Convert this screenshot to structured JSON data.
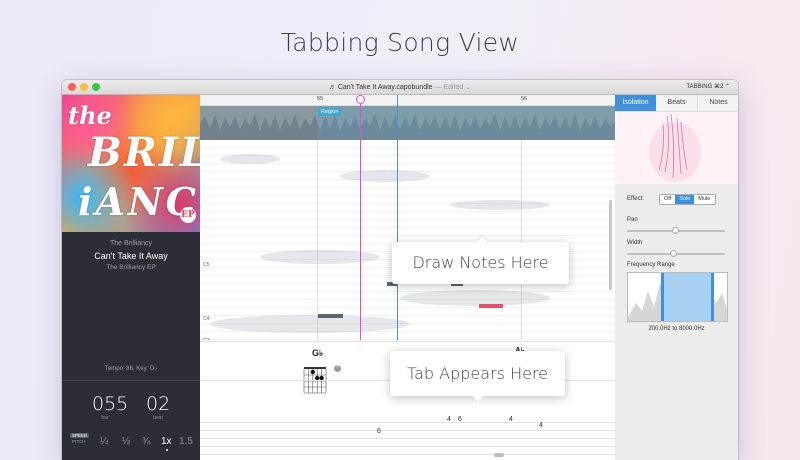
{
  "headline": "Tabbing Song View",
  "window": {
    "doc_icon": "♬",
    "doc_title": "Can't Take It Away.capobundle",
    "doc_status": "— Edited ⌄",
    "mode_menu": "TABBING ⌘2 ⌃"
  },
  "album": {
    "cover_words": [
      "the",
      "BRILL",
      "iANCY",
      "EP"
    ],
    "artist": "The Brilliancy",
    "title": "Can't Take It Away",
    "album": "The Brilliancy EP"
  },
  "transport": {
    "tempo_key": "Tempo: 86, Key: D♭",
    "bar": "055",
    "beat": "02",
    "bar_label": "bar",
    "beat_label": "beat",
    "speed_label": "SPEED",
    "pitch_label": "PITCH",
    "speeds": [
      "¼",
      "½",
      "¾",
      "1x",
      "1.5"
    ],
    "active_speed": "1x"
  },
  "timeline": {
    "ruler_marks": [
      "55",
      "56"
    ],
    "region_label": "Region",
    "note_labels": [
      "C5",
      "C4",
      "G3",
      "C3"
    ]
  },
  "tab": {
    "chord_name": "G♭",
    "chord_name_2": "A♭",
    "info_badge": "?",
    "frets": [
      "4",
      "6",
      "4",
      "4",
      "6"
    ]
  },
  "right_panel": {
    "tabs": [
      "Isolation",
      "Beats",
      "Notes"
    ],
    "active_tab": "Isolation",
    "effect_label": "Effect:",
    "effect_options": [
      "Off",
      "Solo",
      "Mute"
    ],
    "effect_selected": "Solo",
    "pan_label": "Pan",
    "width_label": "Width",
    "freq_label": "Frequency Range",
    "freq_range_text": "200.0Hz to 8000.0Hz"
  },
  "callouts": {
    "draw_notes": "Draw Notes Here",
    "tab_appears": "Tab Appears Here"
  },
  "colors": {
    "accent_blue": "#3f8fd9",
    "playhead_pink": "#d84fd6",
    "note_red": "#e05266",
    "panel_dark": "#2b2f35"
  }
}
